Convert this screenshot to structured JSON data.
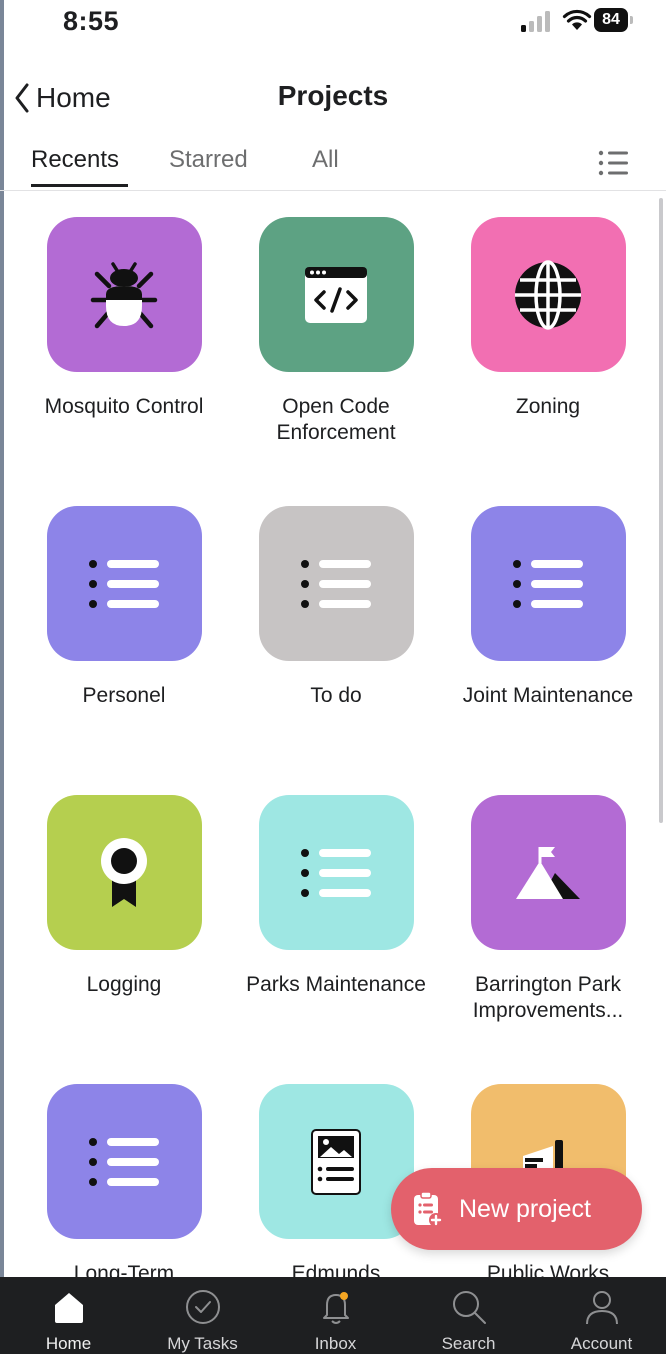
{
  "status_bar": {
    "time": "8:55",
    "battery": "84"
  },
  "header": {
    "back_label": "Home",
    "title": "Projects"
  },
  "tabs": [
    {
      "label": "Recents",
      "active": true
    },
    {
      "label": "Starred",
      "active": false
    },
    {
      "label": "All",
      "active": false
    }
  ],
  "projects": [
    {
      "name": "Mosquito Control",
      "color": "#b36bd4",
      "icon": "bug-icon"
    },
    {
      "name": "Open Code Enforcement",
      "color": "#5da283",
      "icon": "code-window-icon"
    },
    {
      "name": "Zoning",
      "color": "#f26fb2",
      "icon": "globe-icon"
    },
    {
      "name": "Personel",
      "color": "#8d84e8",
      "icon": "list-icon"
    },
    {
      "name": "To do",
      "color": "#c7c4c4",
      "icon": "list-icon"
    },
    {
      "name": "Joint Maintenance",
      "color": "#8d84e8",
      "icon": "list-icon"
    },
    {
      "name": "Logging",
      "color": "#b5cf4f",
      "icon": "ribbon-award-icon"
    },
    {
      "name": "Parks Maintenance",
      "color": "#9ee7e3",
      "icon": "list-icon"
    },
    {
      "name": "Barrington Park Improvements...",
      "color": "#b36bd4",
      "icon": "mountain-flag-icon"
    },
    {
      "name": "Long-Term",
      "color": "#8d84e8",
      "icon": "list-icon"
    },
    {
      "name": "Edmunds",
      "color": "#9ee7e3",
      "icon": "news-doc-icon"
    },
    {
      "name": "Public Works",
      "color": "#f1bd6c",
      "icon": "megaphone-icon"
    }
  ],
  "fab": {
    "label": "New project"
  },
  "bottom_nav": [
    {
      "label": "Home",
      "icon": "home-icon"
    },
    {
      "label": "My Tasks",
      "icon": "check-circle-icon"
    },
    {
      "label": "Inbox",
      "icon": "bell-icon"
    },
    {
      "label": "Search",
      "icon": "search-icon"
    },
    {
      "label": "Account",
      "icon": "account-icon"
    }
  ]
}
